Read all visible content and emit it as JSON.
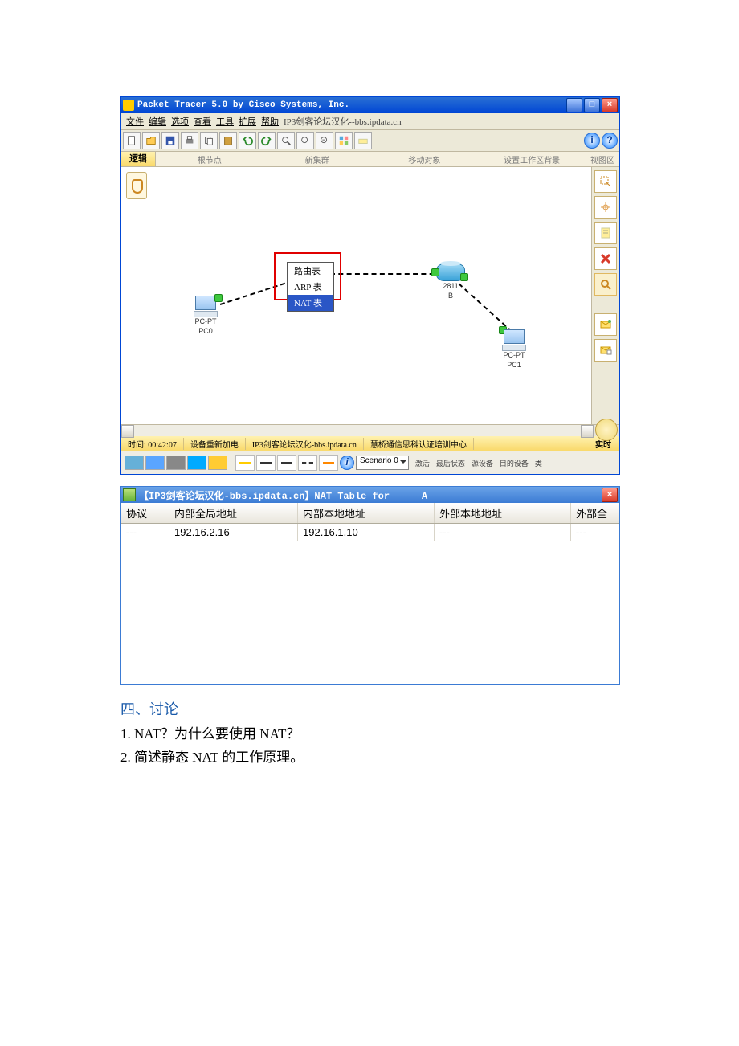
{
  "pt": {
    "title": "Packet Tracer 5.0 by Cisco Systems, Inc.",
    "menus": [
      "文件",
      "编辑",
      "选项",
      "查看",
      "工具",
      "扩展",
      "帮助"
    ],
    "menu_extra": "IP3剑客论坛汉化--bbs.ipdata.cn",
    "subbar": {
      "logic": "逻辑",
      "root": "根节点",
      "new_cluster": "新集群",
      "move_obj": "移动对象",
      "set_bg": "设置工作区背景",
      "viewport": "视图区"
    },
    "context_menu": {
      "routing": "路由表",
      "arp": "ARP 表",
      "nat": "NAT 表"
    },
    "nodes": {
      "pc0": {
        "type": "PC-PT",
        "name": "PC0"
      },
      "routerB": {
        "type": "2811",
        "name": "B"
      },
      "pc1": {
        "type": "PC-PT",
        "name": "PC1"
      }
    },
    "status": {
      "time_label": "时间:",
      "time": "00:42:07",
      "power": "设备重新加电",
      "credit": "IP3剑客论坛汉化-bbs.ipdata.cn",
      "center": "慧桥通信思科认证培训中心",
      "realtime": "实时"
    },
    "scenario": "Scenario 0",
    "mini_labels": [
      "激活",
      "最后状态",
      "源设备",
      "目的设备",
      "类"
    ],
    "help": "?",
    "info": "i"
  },
  "nat": {
    "title_prefix": "【IP3剑客论坛汉化-bbs.ipdata.cn】NAT Table for",
    "title_suffix": "A",
    "close": "×",
    "headers": {
      "proto": "协议",
      "ig": "内部全局地址",
      "il": "内部本地地址",
      "ol": "外部本地地址",
      "og": "外部全"
    },
    "rows": [
      {
        "proto": "---",
        "ig": "192.16.2.16",
        "il": "192.16.1.10",
        "ol": "---",
        "og": "---"
      }
    ]
  },
  "discussion": {
    "heading": "四、讨论",
    "q1": "1. NAT？为什么要使用 NAT？",
    "q2": "2. 简述静态 NAT 的工作原理。"
  },
  "wb": {
    "min": "_",
    "max": "□",
    "close": "×"
  }
}
